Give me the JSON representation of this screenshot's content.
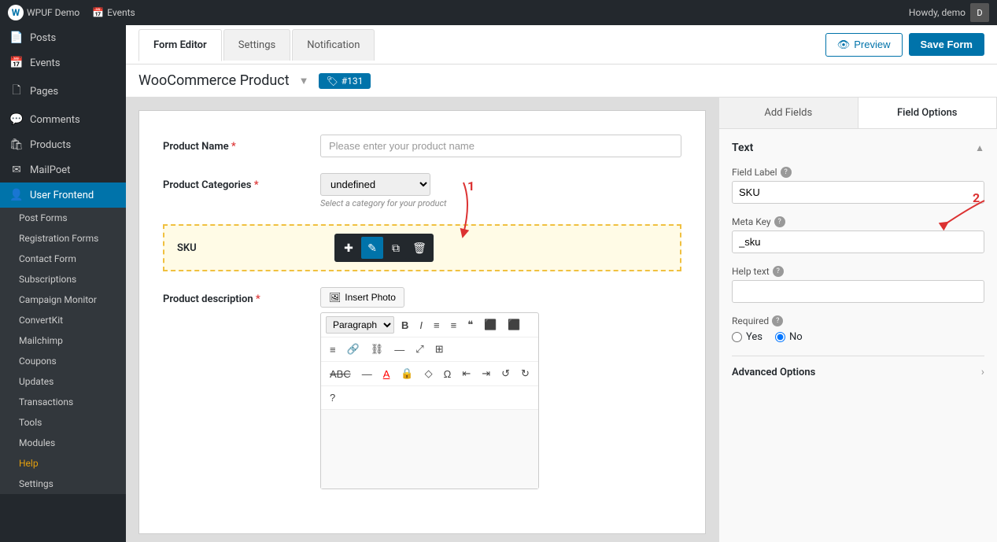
{
  "adminBar": {
    "siteTitle": "WPUF Demo",
    "eventsLabel": "Events",
    "userLabel": "Howdy, demo"
  },
  "sidebar": {
    "items": [
      {
        "id": "posts",
        "label": "Posts",
        "icon": "📄"
      },
      {
        "id": "events",
        "label": "Events",
        "icon": "📅"
      },
      {
        "id": "pages",
        "label": "Pages",
        "icon": "🗋"
      },
      {
        "id": "comments",
        "label": "Comments",
        "icon": "💬"
      },
      {
        "id": "products",
        "label": "Products",
        "icon": "🛍"
      },
      {
        "id": "mailpoet",
        "label": "MailPoet",
        "icon": "✉"
      },
      {
        "id": "user-frontend",
        "label": "User Frontend",
        "icon": "👤",
        "active": true
      }
    ],
    "subItems": [
      {
        "id": "post-forms",
        "label": "Post Forms",
        "active": false
      },
      {
        "id": "registration-forms",
        "label": "Registration Forms",
        "active": false
      },
      {
        "id": "contact-form",
        "label": "Contact Form",
        "active": false
      },
      {
        "id": "subscriptions",
        "label": "Subscriptions",
        "active": false
      },
      {
        "id": "campaign-monitor",
        "label": "Campaign Monitor",
        "active": false
      },
      {
        "id": "convertkit",
        "label": "ConvertKit",
        "active": false
      },
      {
        "id": "mailchimp",
        "label": "Mailchimp",
        "active": false
      },
      {
        "id": "coupons",
        "label": "Coupons",
        "active": false
      },
      {
        "id": "updates",
        "label": "Updates",
        "active": false
      },
      {
        "id": "transactions",
        "label": "Transactions",
        "active": false
      },
      {
        "id": "tools",
        "label": "Tools",
        "active": false
      },
      {
        "id": "modules",
        "label": "Modules",
        "active": false
      },
      {
        "id": "help",
        "label": "Help",
        "active": false,
        "special": true
      },
      {
        "id": "settings",
        "label": "Settings",
        "active": false
      }
    ]
  },
  "tabs": {
    "items": [
      {
        "id": "form-editor",
        "label": "Form Editor",
        "active": true
      },
      {
        "id": "settings",
        "label": "Settings",
        "active": false
      },
      {
        "id": "notification",
        "label": "Notification",
        "active": false
      }
    ],
    "previewLabel": "Preview",
    "saveLabel": "Save Form"
  },
  "formTitle": {
    "name": "WooCommerce Product",
    "badgeLabel": "#131"
  },
  "formFields": {
    "productName": {
      "label": "Product Name",
      "required": true,
      "placeholder": "Please enter your product name"
    },
    "productCategories": {
      "label": "Product Categories",
      "required": true,
      "selectValue": "undefined",
      "hint": "Select a category for your product"
    },
    "sku": {
      "label": "SKU"
    },
    "productDescription": {
      "label": "Product description",
      "required": true,
      "insertPhotoLabel": "Insert Photo",
      "editorParagraphLabel": "Paragraph"
    }
  },
  "rightPanel": {
    "addFieldsLabel": "Add Fields",
    "fieldOptionsLabel": "Field Options",
    "sectionTitle": "Text",
    "fieldLabelLabel": "Field Label",
    "fieldLabelValue": "SKU",
    "metaKeyLabel": "Meta Key",
    "metaKeyValue": "_sku",
    "helpTextLabel": "Help text",
    "helpTextValue": "",
    "requiredLabel": "Required",
    "requiredYes": "Yes",
    "requiredNo": "No",
    "requiredSelected": "no",
    "advancedOptionsLabel": "Advanced Options"
  },
  "annotations": {
    "arrow1": "1",
    "arrow2": "2"
  }
}
